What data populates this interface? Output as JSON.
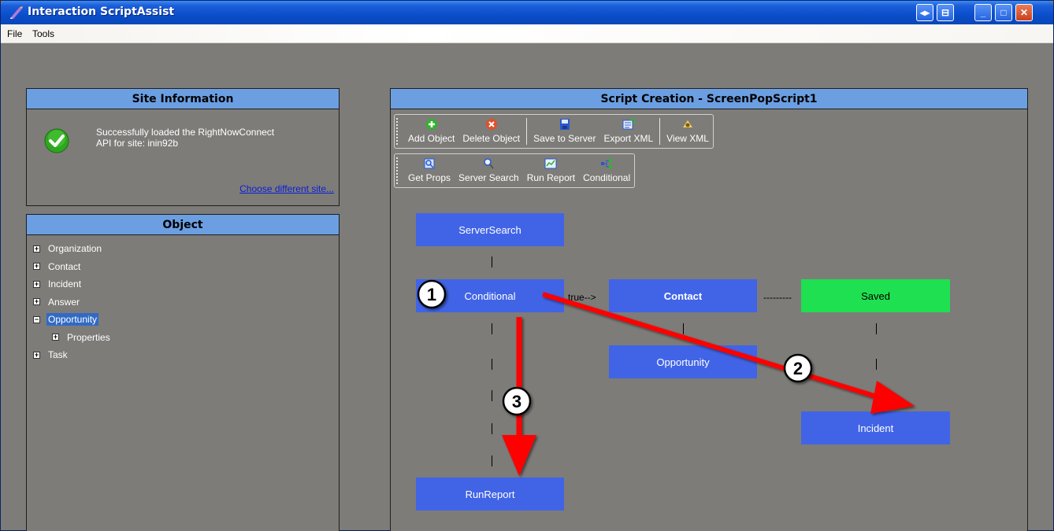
{
  "window": {
    "title": "Interaction ScriptAssist",
    "buttons": [
      "◂▸",
      "⊟",
      "_",
      "□",
      "✕"
    ]
  },
  "menu": {
    "file": "File",
    "tools": "Tools"
  },
  "site_panel": {
    "header": "Site Information",
    "message_line1": "Successfully loaded the RightNowConnect",
    "message_line2": "API for site: inin92b",
    "link": "Choose different site..."
  },
  "object_panel": {
    "header": "Object",
    "items": [
      {
        "label": "Organization",
        "expander": "+"
      },
      {
        "label": "Contact",
        "expander": "+"
      },
      {
        "label": "Incident",
        "expander": "+"
      },
      {
        "label": "Answer",
        "expander": "+"
      },
      {
        "label": "Opportunity",
        "expander": "−",
        "selected": true
      },
      {
        "label": "Properties",
        "expander": "+",
        "child": true
      },
      {
        "label": "Task",
        "expander": "+"
      }
    ]
  },
  "script_panel": {
    "header": "Script Creation - ScreenPopScript1",
    "toolbar1": {
      "add": "Add Object",
      "delete": "Delete Object",
      "save": "Save to Server",
      "export": "Export XML",
      "view": "View XML"
    },
    "toolbar2": {
      "get_props": "Get Props",
      "server_search": "Server Search",
      "run_report": "Run Report",
      "conditional": "Conditional"
    },
    "flow": {
      "server_search": "ServerSearch",
      "conditional": "Conditional",
      "true_label": "true-->",
      "contact": "Contact",
      "dashes": "---------",
      "saved": "Saved",
      "opportunity": "Opportunity",
      "incident": "Incident",
      "run_report": "RunReport"
    }
  },
  "annotations": {
    "badge1": "1",
    "badge2": "2",
    "badge3": "3",
    "arrow_color": "#ff0000"
  }
}
